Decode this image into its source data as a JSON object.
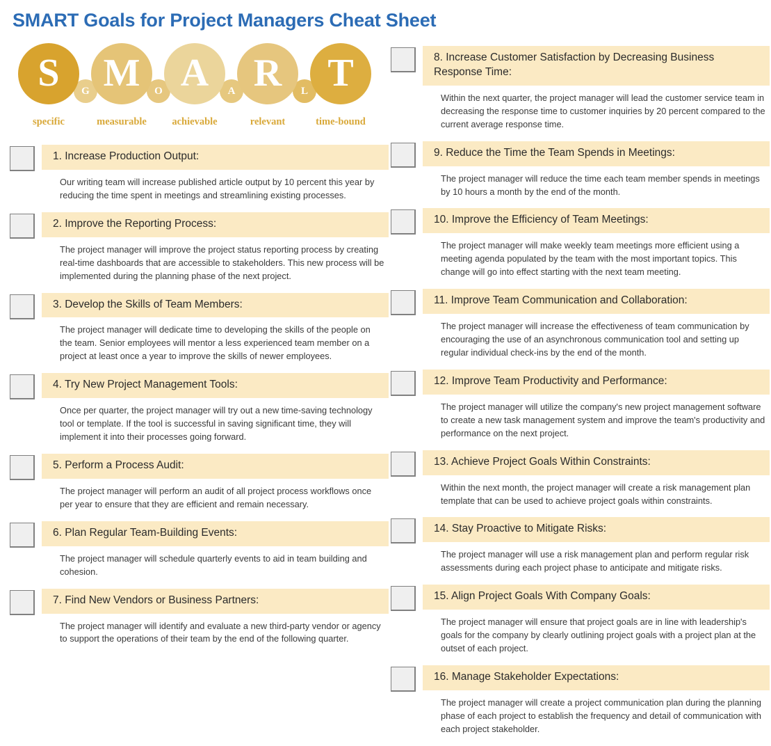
{
  "header": {
    "title": "SMART Goals for Project Managers Cheat Sheet",
    "title_color": "#2C6CB5"
  },
  "logo": {
    "big_circles": [
      {
        "letter": "S",
        "label": "specific",
        "color": "#D8A32E"
      },
      {
        "letter": "M",
        "label": "measurable",
        "color": "#E5C477"
      },
      {
        "letter": "A",
        "label": "achievable",
        "color": "#EBD59B"
      },
      {
        "letter": "R",
        "label": "relevant",
        "color": "#E6C67E"
      },
      {
        "letter": "T",
        "label": "time-bound",
        "color": "#DDAE40"
      }
    ],
    "small_circles": [
      {
        "letter": "G",
        "color": "#E9CE8C"
      },
      {
        "letter": "O",
        "color": "#E6C77F"
      },
      {
        "letter": "A",
        "color": "#E6C87F"
      },
      {
        "letter": "L",
        "color": "#E2BC63"
      }
    ],
    "label_color": "#D9A93A"
  },
  "style": {
    "header_bar_color": "#FBEAC4",
    "checkbox_fill": "#EFEFEF",
    "checkbox_border": "#808080"
  },
  "goals": {
    "left": [
      {
        "title": "1. Increase Production Output:",
        "description": "Our writing team will increase published article output by 10 percent this year by reducing the time spent in meetings and streamlining existing processes."
      },
      {
        "title": "2. Improve the Reporting Process:",
        "description": "The project manager will improve the project status reporting process by creating real-time dashboards that are accessible to stakeholders. This new process will be implemented during the planning phase of the next project."
      },
      {
        "title": "3. Develop the Skills of Team Members:",
        "description": "The project manager will dedicate time to developing the skills of the people on the team. Senior employees will mentor a less experienced team member on a project at least once a year to improve the skills of newer employees."
      },
      {
        "title": "4. Try New Project Management Tools:",
        "description": "Once per quarter, the project manager will try out a new time-saving technology tool or template. If the tool is successful in saving significant time, they will implement it into their processes going forward."
      },
      {
        "title": "5. Perform a Process Audit:",
        "description": "The project manager will perform an audit of all project process workflows once per year to ensure that they are efficient and remain necessary."
      },
      {
        "title": "6. Plan Regular Team-Building Events:",
        "description": "The project manager will schedule quarterly events to aid in team building and cohesion."
      },
      {
        "title": "7. Find New Vendors or Business Partners:",
        "description": "The project manager will identify and evaluate a new third-party vendor or agency to support the operations of their team by the end of the following quarter."
      }
    ],
    "right": [
      {
        "title": "8. Increase Customer Satisfaction by Decreasing Business Response Time:",
        "description": "Within the next quarter, the project manager will lead the customer service team in decreasing the response time to customer inquiries by 20 percent compared to the current average response time."
      },
      {
        "title": "9. Reduce the Time the Team Spends in Meetings:",
        "description": "The project manager will reduce the time each team member spends in meetings by 10 hours a month by the end of the month."
      },
      {
        "title": "10. Improve the Efficiency of Team Meetings:",
        "description": "The project manager will make weekly team meetings more efficient using a meeting agenda populated by the team with the most important topics. This change will go into effect starting with the next team meeting."
      },
      {
        "title": "11. Improve Team Communication and Collaboration:",
        "description": "The project manager will increase the effectiveness of team communication by encouraging the use of an asynchronous communication tool and setting up regular individual check-ins by the end of the month."
      },
      {
        "title": "12. Improve Team Productivity and Performance:",
        "description": "The project manager will utilize the company's new project management software to create a new task management system and improve the team's productivity and performance on the next project."
      },
      {
        "title": "13. Achieve Project Goals Within Constraints:",
        "description": "Within the next month, the project manager will create a risk management plan template that can be used to achieve project goals within constraints."
      },
      {
        "title": "14. Stay Proactive to Mitigate Risks:",
        "description": "The project manager will use a risk management plan and perform regular risk assessments during each project phase to anticipate and mitigate risks."
      },
      {
        "title": "15. Align Project Goals With Company Goals:",
        "description": "The project manager will ensure that project goals are in line with leadership's goals for the company by clearly outlining project goals with a project plan at the outset of each project."
      },
      {
        "title": "16. Manage Stakeholder Expectations:",
        "description": "The project manager will create a project communication plan during the planning phase of each project to establish the frequency and detail of communication with each project stakeholder."
      }
    ]
  }
}
